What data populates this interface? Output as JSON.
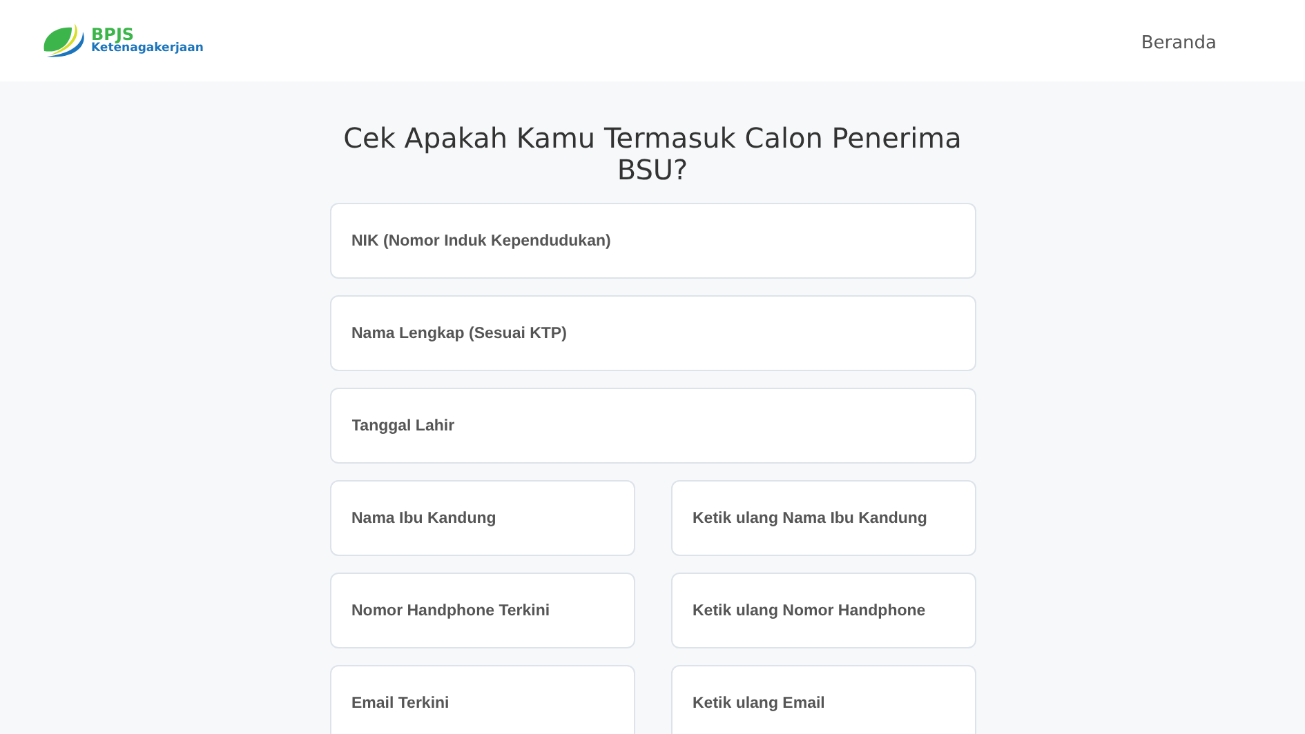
{
  "header": {
    "logo": {
      "line1": "BPJS",
      "line2": "Ketenagakerjaan"
    },
    "nav": [
      "Beranda"
    ]
  },
  "form": {
    "title": "Cek Apakah Kamu Termasuk Calon Penerima BSU?",
    "rows": [
      [
        {
          "placeholder": "NIK (Nomor Induk Kependudukan)"
        }
      ],
      [
        {
          "placeholder": "Nama Lengkap (Sesuai KTP)"
        }
      ],
      [
        {
          "placeholder": "Tanggal Lahir"
        }
      ],
      [
        {
          "placeholder": "Nama Ibu Kandung"
        },
        {
          "placeholder": "Ketik ulang Nama Ibu Kandung"
        }
      ],
      [
        {
          "placeholder": "Nomor Handphone Terkini"
        },
        {
          "placeholder": "Ketik ulang Nomor Handphone"
        }
      ],
      [
        {
          "placeholder": "Email Terkini"
        },
        {
          "placeholder": "Ketik ulang Email"
        }
      ]
    ]
  }
}
